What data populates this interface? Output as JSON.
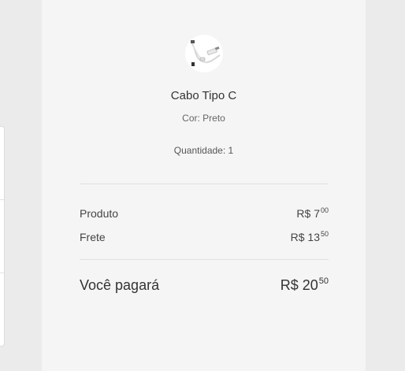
{
  "product": {
    "name": "Cabo Tipo C",
    "variant": "Cor: Preto",
    "quantity": "Quantidade: 1",
    "image_icon": "usb-c-cable-icon"
  },
  "costs": {
    "product_label": "Produto",
    "product_price_main": "R$ 7",
    "product_price_cents": "00",
    "shipping_label": "Frete",
    "shipping_price_main": "R$ 13",
    "shipping_price_cents": "50"
  },
  "total": {
    "label": "Você pagará",
    "price_main": "R$ 20",
    "price_cents": "50"
  }
}
